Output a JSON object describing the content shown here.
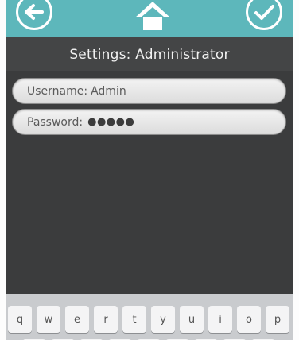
{
  "header": {
    "title": "Settings: Administrator",
    "back_icon": "arrow-left-icon",
    "home_icon": "home-icon",
    "confirm_icon": "checkmark-icon",
    "accent_color": "#5db7bb"
  },
  "form": {
    "username_label": "Username:",
    "username_value": "Admin",
    "password_label": "Password:",
    "password_value": "●●●●●"
  },
  "keyboard": {
    "row1": [
      "q",
      "w",
      "e",
      "r",
      "t",
      "y",
      "u",
      "i",
      "o",
      "p"
    ]
  }
}
